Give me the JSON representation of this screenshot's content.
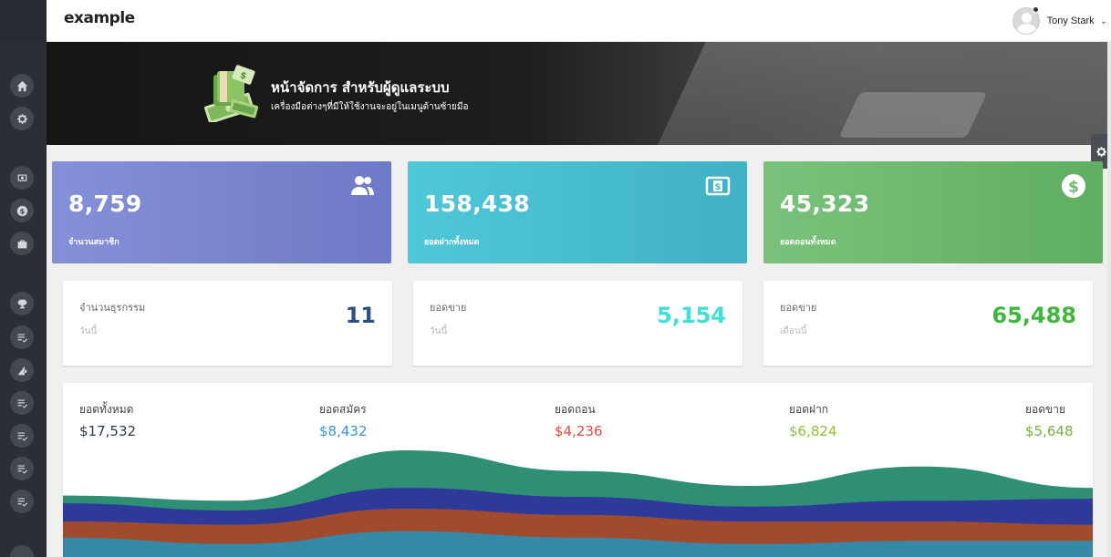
{
  "brand": {
    "logo": "example"
  },
  "user": {
    "name": "Tony Stark"
  },
  "banner": {
    "title": "หน้าจัดการ สำหรับผู้ดูแลระบบ",
    "subtitle": "เครื่องมือต่างๆที่มีให้ใช้งานจะอยู่ในเมนูด้านซ้ายมือ"
  },
  "sidebar": {
    "icons": [
      "home-icon",
      "gear-icon",
      "monitor-icon",
      "dollar-circle-icon",
      "toolbox-icon",
      "trophy-icon",
      "list-check-icon",
      "sheet-gear-icon",
      "list-check-icon",
      "list-check-icon",
      "list-check-icon",
      "list-check-icon"
    ]
  },
  "stats": [
    {
      "value": "8,759",
      "label": "จำนวนสมาชิก",
      "icon": "users-icon",
      "color": "#7c87d2"
    },
    {
      "value": "158,438",
      "label": "ยอดฝากทั้งหมด",
      "icon": "money-bill-icon",
      "color": "#48bed2"
    },
    {
      "value": "45,323",
      "label": "ยอดถอนทั้งหมด",
      "icon": "dollar-circle-icon",
      "color": "#6fb970"
    }
  ],
  "info": [
    {
      "title": "จำนวนธุรกรรม",
      "sub": "วันนี้",
      "value": "11",
      "color": "#2a4f87"
    },
    {
      "title": "ยอดขาย",
      "sub": "วันนี้",
      "value": "5,154",
      "color": "#3fe0d6"
    },
    {
      "title": "ยอดขาย",
      "sub": "เดือนนี้",
      "value": "65,488",
      "color": "#3fb83d"
    }
  ],
  "summary": [
    {
      "label": "ยอดทั้งหมด",
      "value": "$17,532",
      "color": "#2d3a4a"
    },
    {
      "label": "ยอดสมัคร",
      "value": "$8,432",
      "color": "#3a93d8"
    },
    {
      "label": "ยอดถอน",
      "value": "$4,236",
      "color": "#e04a3c"
    },
    {
      "label": "ยอดฝาก",
      "value": "$6,824",
      "color": "#8fc23b"
    },
    {
      "label": "ยอดขาย",
      "value": "$5,648",
      "color": "#71b53a"
    }
  ],
  "chart_data": {
    "type": "area",
    "title": "",
    "series": [
      {
        "values": [
          3,
          2,
          4,
          3,
          2,
          2.5,
          2.5
        ],
        "color": "#3589a6"
      },
      {
        "values": [
          2.5,
          3,
          3.5,
          3.5,
          3.5,
          3,
          2.5
        ],
        "color": "#a24a2e"
      },
      {
        "values": [
          2.8,
          2.2,
          3.2,
          2.8,
          2.3,
          3.2,
          4
        ],
        "color": "#2e3a9a"
      },
      {
        "values": [
          1.2,
          1.5,
          5.8,
          4,
          3.2,
          5.3,
          1.7
        ],
        "color": "#2f8f74"
      }
    ]
  }
}
